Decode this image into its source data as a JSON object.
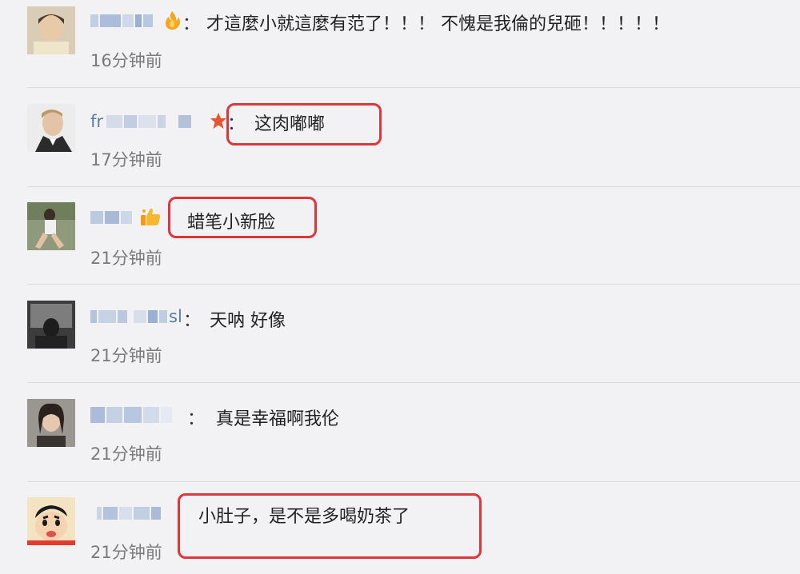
{
  "comments": [
    {
      "username": "",
      "text": "才這麼小就這麼有范了！！！ 不愧是我倫的兒砸！！！！！",
      "time": "16分钟前",
      "avatar": "avatar-child-icon",
      "badge": "fire-badge-icon"
    },
    {
      "username": "fr",
      "text": "这肉嘟嘟",
      "time": "17分钟前",
      "avatar": "avatar-man-suit-icon",
      "badge": "star-badge-icon"
    },
    {
      "username": "",
      "text": "蜡笔小新脸",
      "time": "21分钟前",
      "avatar": "avatar-woman-sitting-icon",
      "badge": "thumbs-up-badge-icon"
    },
    {
      "username": "sl",
      "text": "天呐 好像",
      "time": "21分钟前",
      "avatar": "avatar-dark-photo-icon",
      "badge": ""
    },
    {
      "username": "",
      "text": "真是幸福啊我伦",
      "time": "21分钟前",
      "avatar": "avatar-girl-car-icon",
      "badge": ""
    },
    {
      "username": "",
      "text": "小肚子，是不是多喝奶茶了",
      "time": "21分钟前",
      "avatar": "avatar-crayon-shinchan-icon",
      "badge": ""
    }
  ],
  "colon": "：",
  "colors": {
    "background": "#f2f2f5",
    "username": "#5b7ea6",
    "highlight": "#e0353b",
    "time": "#7a7a7a"
  }
}
